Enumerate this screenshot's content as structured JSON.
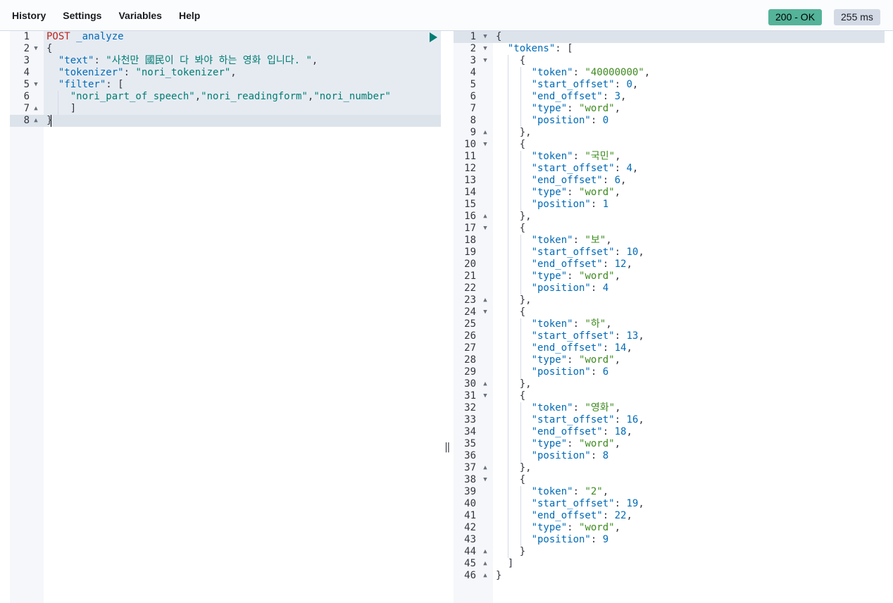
{
  "menu": {
    "items": [
      "History",
      "Settings",
      "Variables",
      "Help"
    ]
  },
  "response_status": {
    "status": "200 - OK",
    "time": "255 ms",
    "status_color": "#54b399"
  },
  "request": {
    "lines": [
      [
        [
          "tok-method",
          "POST"
        ],
        [
          "tok-path",
          " _analyze"
        ]
      ],
      [
        [
          "tok-punc",
          "{"
        ]
      ],
      [
        [
          "tok-punc",
          "  "
        ],
        [
          "tok-key",
          "\"text\""
        ],
        [
          "tok-punc",
          ": "
        ],
        [
          "tok-str",
          "\"사천만 國民이 다 봐야 하는 영화 입니다. \""
        ],
        [
          "tok-punc",
          ","
        ]
      ],
      [
        [
          "tok-punc",
          "  "
        ],
        [
          "tok-key",
          "\"tokenizer\""
        ],
        [
          "tok-punc",
          ": "
        ],
        [
          "tok-str",
          "\"nori_tokenizer\""
        ],
        [
          "tok-punc",
          ","
        ]
      ],
      [
        [
          "tok-punc",
          "  "
        ],
        [
          "tok-key",
          "\"filter\""
        ],
        [
          "tok-punc",
          ": ["
        ]
      ],
      [
        [
          "tok-punc",
          "    "
        ],
        [
          "tok-str",
          "\"nori_part_of_speech\""
        ],
        [
          "tok-punc",
          ","
        ],
        [
          "tok-str",
          "\"nori_readingform\""
        ],
        [
          "tok-punc",
          ","
        ],
        [
          "tok-str",
          "\"nori_number\""
        ]
      ],
      [
        [
          "tok-punc",
          "    ]"
        ]
      ],
      [
        [
          "tok-punc",
          "}"
        ]
      ]
    ],
    "folds": [
      "",
      "▼",
      "",
      "",
      "▼",
      "",
      "▲",
      "▲"
    ]
  },
  "response": {
    "tokens": [
      {
        "token": "\"40000000\"",
        "start_offset": "0",
        "end_offset": "3",
        "type": "\"word\"",
        "position": "0"
      },
      {
        "token": "\"국민\"",
        "start_offset": "4",
        "end_offset": "6",
        "type": "\"word\"",
        "position": "1"
      },
      {
        "token": "\"보\"",
        "start_offset": "10",
        "end_offset": "12",
        "type": "\"word\"",
        "position": "4"
      },
      {
        "token": "\"하\"",
        "start_offset": "13",
        "end_offset": "14",
        "type": "\"word\"",
        "position": "6"
      },
      {
        "token": "\"영화\"",
        "start_offset": "16",
        "end_offset": "18",
        "type": "\"word\"",
        "position": "8"
      },
      {
        "token": "\"2\"",
        "start_offset": "19",
        "end_offset": "22",
        "type": "\"word\"",
        "position": "9"
      }
    ]
  },
  "splitter": {
    "glyph": "‖"
  }
}
